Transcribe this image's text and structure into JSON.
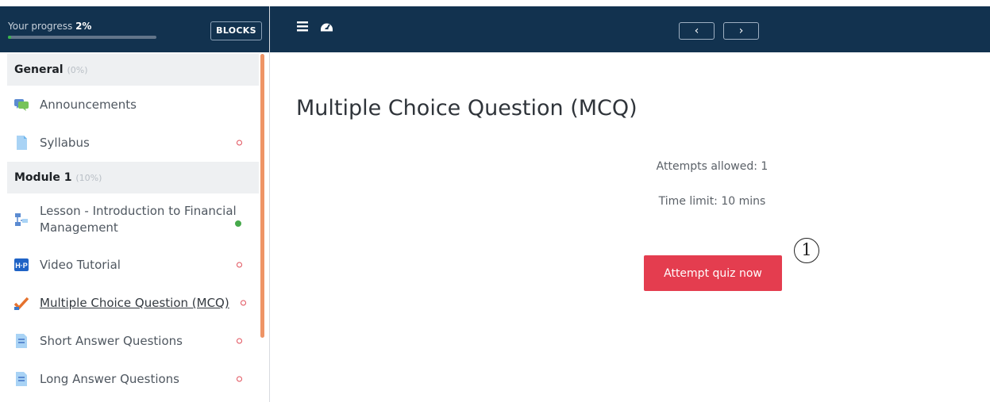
{
  "sidebar": {
    "progress_label": "Your progress",
    "progress_value": "2%",
    "progress_fraction": 0.02,
    "blocks_button": "BLOCKS",
    "sections": [
      {
        "title": "General",
        "pct": "(0%)",
        "items": [
          {
            "label": "Announcements",
            "icon": "forum-icon",
            "status": "none"
          },
          {
            "label": "Syllabus",
            "icon": "file-icon",
            "status": "incomplete"
          }
        ]
      },
      {
        "title": "Module 1",
        "pct": "(10%)",
        "items": [
          {
            "label": "Lesson - Introduction to Financial Management",
            "icon": "lesson-icon",
            "status": "complete"
          },
          {
            "label": "Video Tutorial",
            "icon": "h5p-icon",
            "status": "incomplete"
          },
          {
            "label": "Multiple Choice Question (MCQ)",
            "icon": "quiz-icon",
            "status": "incomplete",
            "current": true
          },
          {
            "label": "Short Answer Questions",
            "icon": "assignment-icon",
            "status": "incomplete"
          },
          {
            "label": "Long Answer Questions",
            "icon": "assignment-icon",
            "status": "incomplete"
          }
        ]
      }
    ],
    "scroll_color": "#ee9466"
  },
  "navbar": {
    "menu_icon": "hamburger-icon",
    "dashboard_icon": "dashboard-icon",
    "prev_glyph": "‹",
    "next_glyph": "›"
  },
  "main": {
    "title": "Multiple Choice Question (MCQ)",
    "attempts": "Attempts allowed: 1",
    "time_limit": "Time limit: 10 mins",
    "attempt_button": "Attempt quiz now"
  },
  "annotation": {
    "marker": "1"
  },
  "colors": {
    "nav": "#12324f",
    "primary_button": "#e43d4f",
    "complete": "#46a94b",
    "incomplete": "#e1505b"
  }
}
